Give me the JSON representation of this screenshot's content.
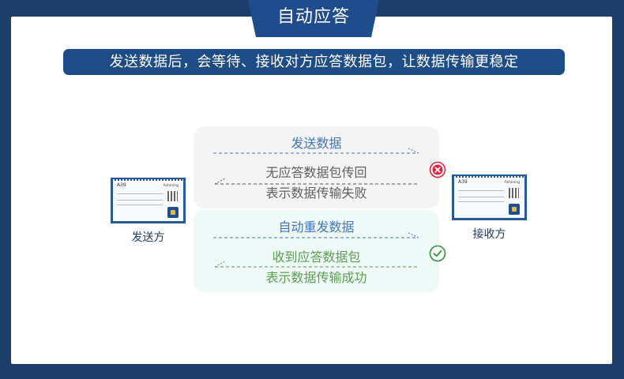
{
  "header": {
    "title": "自动应答",
    "subtitle": "发送数据后，会等待、接收对方应答数据包，让数据传输更稳定"
  },
  "sender": {
    "label": "发送方",
    "module": {
      "model": "A39",
      "brand": "Ashining"
    }
  },
  "receiver": {
    "label": "接收方",
    "module": {
      "model": "A39",
      "brand": "Ashining"
    }
  },
  "scenarios": [
    {
      "status": "fail",
      "status_icon": "cross-circle-icon",
      "status_color": "#e0243f",
      "send_label": "发送数据",
      "reply_label": "无应答数据包传回",
      "result_label": "表示数据传输失败"
    },
    {
      "status": "success",
      "status_icon": "check-circle-icon",
      "status_color": "#3f9a46",
      "send_label": "自动重发数据",
      "reply_label": "收到应答数据包",
      "result_label": "表示数据传输成功"
    }
  ],
  "colors": {
    "background": "#1d3d6b",
    "header_tab": "#1f4c8d",
    "subtitle_bar": "#1d4c87",
    "send_text": "#3f78bd",
    "fail_text": "#606060",
    "success_text": "#5a9f4d"
  }
}
